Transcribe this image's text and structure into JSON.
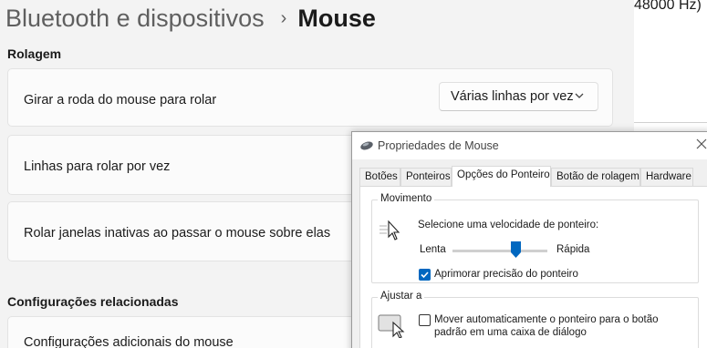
{
  "settings": {
    "breadcrumb": {
      "parent": "Bluetooth e dispositivos",
      "separator": "›",
      "current": "Mouse"
    },
    "sections": {
      "scrolling": "Rolagem",
      "related": "Configurações relacionadas"
    },
    "rows": [
      {
        "label": "Girar a roda do mouse para rolar",
        "value": "Várias linhas por vez"
      },
      {
        "label": "Linhas para rolar por vez"
      },
      {
        "label": "Rolar janelas inativas ao passar o mouse sobre elas"
      },
      {
        "label": "Configurações adicionais do mouse"
      }
    ]
  },
  "background_window": {
    "text": "48000 Hz)"
  },
  "dialog": {
    "title": "Propriedades de Mouse",
    "tabs": [
      "Botões",
      "Ponteiros",
      "Opções do Ponteiro",
      "Botão de rolagem",
      "Hardware"
    ],
    "active_tab": "Opções do Ponteiro",
    "motion": {
      "group_title": "Movimento",
      "prompt": "Selecione uma velocidade de ponteiro:",
      "slow_label": "Lenta",
      "fast_label": "Rápida",
      "speed_fraction": 0.67,
      "precision_label": "Aprimorar precisão do ponteiro",
      "precision_checked": true
    },
    "snap": {
      "group_title": "Ajustar a",
      "line1": "Mover automaticamente o ponteiro para o botão",
      "line2": "padrão em uma caixa de diálogo",
      "checked": false
    }
  }
}
